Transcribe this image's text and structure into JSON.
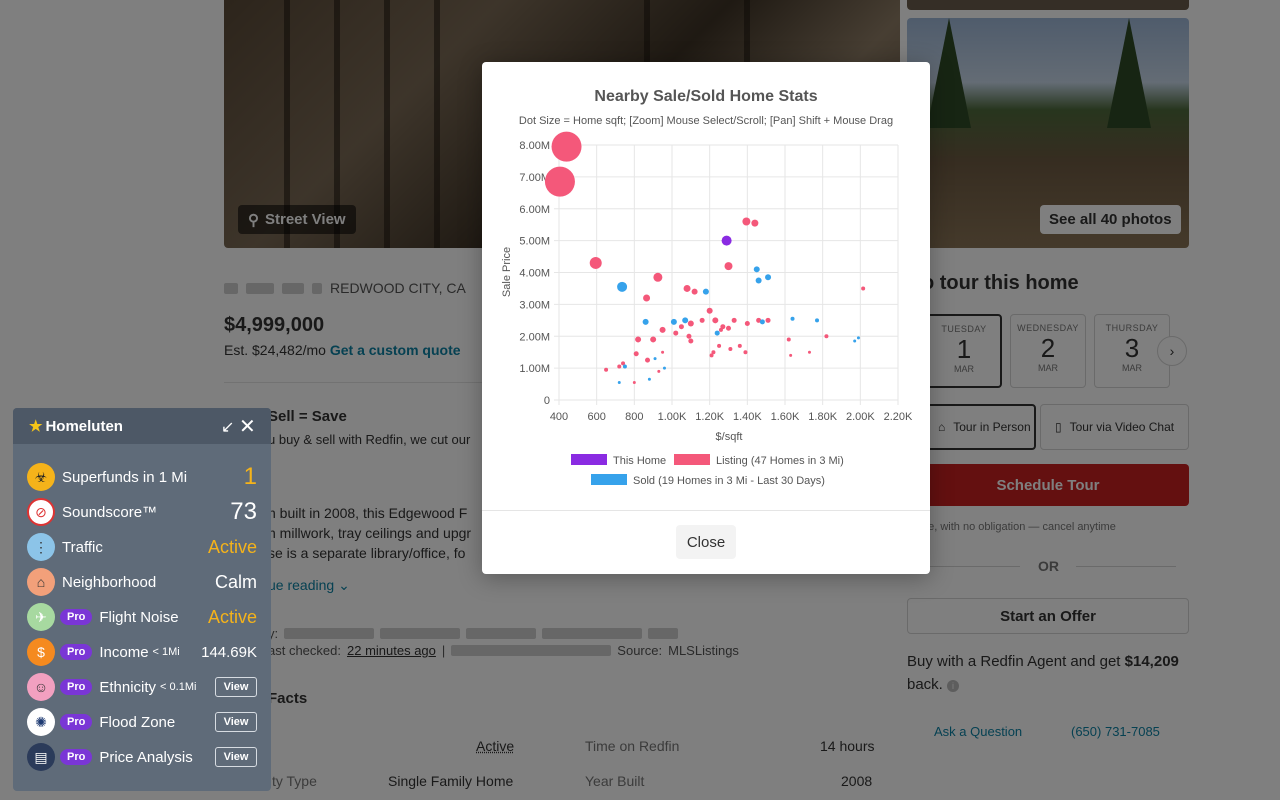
{
  "listing": {
    "street_view_label": "Street View",
    "see_photos_label": "See all 40 photos",
    "address_visible": "REDWOOD CITY, CA",
    "price": "$4,999,000",
    "est_payment": "Est. $24,482/mo",
    "custom_quote_label": "Get a custom quote",
    "sell_title": "Sell = Save",
    "sell_text": "u buy & sell with Redfin, we cut our",
    "description_lines": [
      "n built in 2008, this Edgewood F",
      "n millwork, tray ceilings and upgr",
      "se is a separate library/office, fo"
    ],
    "continue_label": "ue reading",
    "listing_prefix": "y:",
    "last_checked_prefix": "ast checked:",
    "last_checked_value": "22 minutes ago",
    "source_label": "Source:",
    "source_value": "MLSListings",
    "facts_title": "Facts",
    "facts": {
      "status_value": "Active",
      "time_on_redfin_label": "Time on Redfin",
      "time_on_redfin_value": "14 hours",
      "property_type_label": "ty Type",
      "property_type_value": "Single Family Home",
      "year_built_label": "Year Built",
      "year_built_value": "2008"
    }
  },
  "tour": {
    "title": "o tour this home",
    "days": [
      {
        "dow": "TUESDAY",
        "num": "1",
        "mon": "MAR"
      },
      {
        "dow": "WEDNESDAY",
        "num": "2",
        "mon": "MAR"
      },
      {
        "dow": "THURSDAY",
        "num": "3",
        "mon": "MAR"
      }
    ],
    "next_icon": "chevron-right-icon",
    "in_person_label": "Tour in Person",
    "video_label": "Tour via Video Chat",
    "schedule_label": "Schedule Tour",
    "free_note": "ee, with no obligation — cancel anytime",
    "or_label": "OR",
    "offer_label": "Start an Offer",
    "agent_text": "Buy with a Redfin Agent and get",
    "agent_amount": "$14,209",
    "agent_text_end": "back.",
    "ask_label": "Ask a Question",
    "phone": "(650) 731-7085"
  },
  "modal": {
    "close_label": "Close"
  },
  "chart_data": {
    "type": "scatter",
    "title": "Nearby Sale/Sold Home Stats",
    "subtitle": "Dot Size = Home sqft; [Zoom] Mouse Select/Scroll; [Pan] Shift + Mouse Drag",
    "xlabel": "$/sqft",
    "ylabel": "Sale Price",
    "xlim": [
      400,
      2200
    ],
    "ylim": [
      0,
      8000000
    ],
    "x_ticks": [
      "400",
      "600",
      "800",
      "1.00K",
      "1.20K",
      "1.40K",
      "1.60K",
      "1.80K",
      "2.00K",
      "2.20K"
    ],
    "y_ticks": [
      "0",
      "1.00M",
      "2.00M",
      "3.00M",
      "4.00M",
      "5.00M",
      "6.00M",
      "7.00M",
      "8.00M"
    ],
    "grid": true,
    "legend_position": "bottom",
    "series": [
      {
        "name": "This Home",
        "color": "#8a2be2",
        "points": [
          [
            1290,
            5000000,
            5
          ]
        ]
      },
      {
        "name": "Listing (47 Homes in 3 Mi)",
        "color": "#f4587a",
        "points": [
          [
            440,
            7950000,
            15
          ],
          [
            405,
            6850000,
            15
          ],
          [
            595,
            4300000,
            6
          ],
          [
            925,
            3850000,
            4.5
          ],
          [
            1395,
            5600000,
            4
          ],
          [
            1440,
            5550000,
            3.5
          ],
          [
            1300,
            4200000,
            4
          ],
          [
            1080,
            3500000,
            3.5
          ],
          [
            1120,
            3400000,
            3
          ],
          [
            865,
            3200000,
            3.5
          ],
          [
            1510,
            2500000,
            2.5
          ],
          [
            1100,
            2400000,
            3
          ],
          [
            1200,
            2800000,
            3
          ],
          [
            1230,
            2500000,
            3
          ],
          [
            1330,
            2500000,
            2.5
          ],
          [
            1400,
            2400000,
            2.5
          ],
          [
            1460,
            2500000,
            2.5
          ],
          [
            1050,
            2300000,
            2.5
          ],
          [
            1160,
            2500000,
            2.5
          ],
          [
            1270,
            2300000,
            2.5
          ],
          [
            1300,
            2250000,
            2.5
          ],
          [
            950,
            2200000,
            3
          ],
          [
            1020,
            2100000,
            2.5
          ],
          [
            1090,
            2000000,
            2.5
          ],
          [
            1100,
            1850000,
            2.5
          ],
          [
            900,
            1900000,
            3
          ],
          [
            820,
            1900000,
            3
          ],
          [
            1250,
            1700000,
            2
          ],
          [
            1360,
            1700000,
            2
          ],
          [
            810,
            1450000,
            2.5
          ],
          [
            870,
            1250000,
            2.5
          ],
          [
            740,
            1150000,
            2
          ],
          [
            720,
            1050000,
            2
          ],
          [
            650,
            950000,
            2
          ],
          [
            1210,
            1400000,
            2
          ],
          [
            1220,
            1500000,
            2
          ],
          [
            1310,
            1600000,
            2
          ],
          [
            1390,
            1500000,
            2
          ],
          [
            1620,
            1900000,
            2
          ],
          [
            1820,
            2000000,
            2
          ],
          [
            1730,
            1500000,
            1.5
          ],
          [
            2015,
            3500000,
            2
          ],
          [
            800,
            550000,
            1.5
          ],
          [
            930,
            900000,
            1.5
          ],
          [
            1630,
            1400000,
            1.5
          ],
          [
            1260,
            2200000,
            2
          ],
          [
            950,
            1500000,
            1.5
          ]
        ]
      },
      {
        "name": "Sold (19 Homes in 3 Mi - Last 30 Days)",
        "color": "#36a2eb",
        "points": [
          [
            735,
            3550000,
            5
          ],
          [
            1450,
            4100000,
            3
          ],
          [
            1460,
            3750000,
            3
          ],
          [
            1510,
            3850000,
            3
          ],
          [
            1180,
            3400000,
            3
          ],
          [
            1070,
            2500000,
            3
          ],
          [
            860,
            2450000,
            3
          ],
          [
            1010,
            2450000,
            3
          ],
          [
            1240,
            2100000,
            2.5
          ],
          [
            1480,
            2450000,
            2.5
          ],
          [
            1640,
            2550000,
            2
          ],
          [
            1770,
            2500000,
            2
          ],
          [
            1990,
            1950000,
            1.5
          ],
          [
            1970,
            1850000,
            1.5
          ],
          [
            750,
            1050000,
            2
          ],
          [
            720,
            550000,
            1.5
          ],
          [
            880,
            650000,
            1.5
          ],
          [
            960,
            1000000,
            1.5
          ],
          [
            910,
            1300000,
            1.5
          ]
        ]
      }
    ]
  },
  "widget": {
    "title": "Homeluten",
    "star_icon": "star-icon",
    "minimize_icon": "arrow-in-icon",
    "close_icon": "close-icon",
    "pro_label": "Pro",
    "view_label": "View",
    "rows": [
      {
        "label": "Superfunds in 1 Mi",
        "value": "1",
        "icon": "biohazard-icon"
      },
      {
        "label": "Soundscore™",
        "value": "73",
        "icon": "no-noise-icon"
      },
      {
        "label": "Traffic",
        "value": "Active",
        "icon": "traffic-light-icon"
      },
      {
        "label": "Neighborhood",
        "value": "Calm",
        "icon": "neighborhood-icon"
      },
      {
        "label": "Flight Noise",
        "value": "Active",
        "icon": "airplane-icon"
      },
      {
        "label": "Income",
        "sub": "< 1Mi",
        "value": "144.69K",
        "icon": "money-icon"
      },
      {
        "label": "Ethnicity",
        "sub": "< 0.1Mi",
        "icon": "person-icon"
      },
      {
        "label": "Flood Zone",
        "icon": "seal-icon"
      },
      {
        "label": "Price Analysis",
        "icon": "clipboard-icon"
      }
    ]
  }
}
